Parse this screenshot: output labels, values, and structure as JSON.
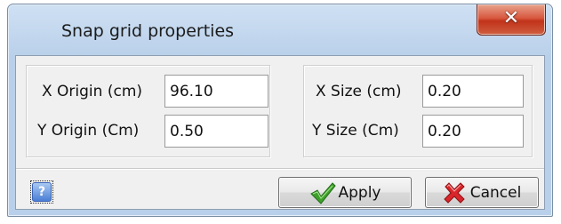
{
  "window": {
    "title": "Snap grid properties",
    "close_icon": "close-icon"
  },
  "origin_group": {
    "x_label": "X Origin (cm)",
    "x_value": "96.10",
    "y_label": "Y Origin (Cm)",
    "y_value": "0.50"
  },
  "size_group": {
    "x_label": "X Size (cm)",
    "x_value": "0.20",
    "y_label": "Y Size (Cm)",
    "y_value": "0.20"
  },
  "footer": {
    "help_icon": "help-icon",
    "help_glyph": "?",
    "apply_label": "Apply",
    "apply_icon": "check-icon",
    "cancel_label": "Cancel",
    "cancel_icon": "x-icon"
  },
  "colors": {
    "close_button": "#c9402a",
    "check_icon": "#3fa02a",
    "x_icon": "#d8262a",
    "help_icon": "#4a7fd4"
  }
}
